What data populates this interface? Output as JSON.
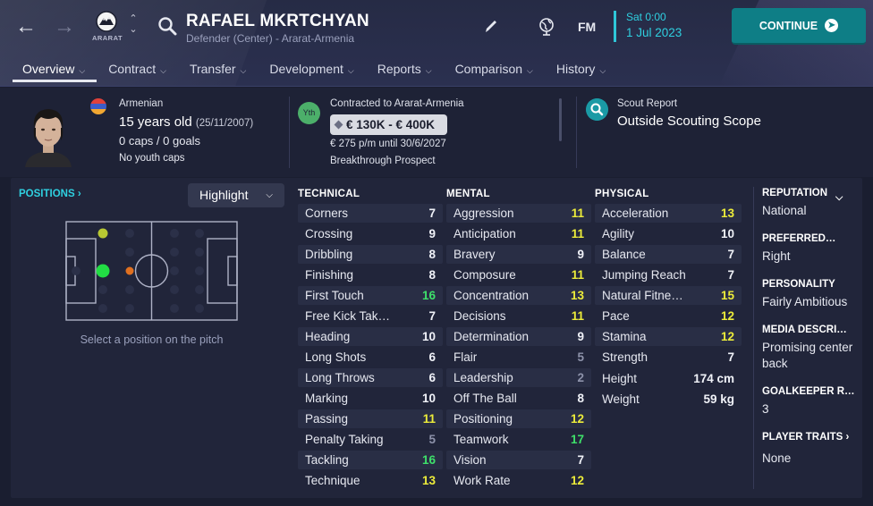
{
  "header": {
    "club_name": "ARARAT",
    "player_name": "RAFAEL MKRTCHYAN",
    "subtitle": "Defender (Center) - Ararat-Armenia",
    "date_day": "Sat 0:00",
    "date_date": "1 Jul 2023",
    "fm_label": "FM",
    "continue_label": "CONTINUE",
    "icons": {
      "back": "arrow-left-icon",
      "forward": "arrow-right-icon",
      "search": "search-icon",
      "edit": "pencil-icon",
      "world": "globe-icon"
    }
  },
  "tabs": [
    {
      "label": "Overview"
    },
    {
      "label": "Contract"
    },
    {
      "label": "Transfer"
    },
    {
      "label": "Development"
    },
    {
      "label": "Reports"
    },
    {
      "label": "Comparison"
    },
    {
      "label": "History"
    }
  ],
  "info": {
    "nationality": "Armenian",
    "age": "15 years old",
    "dob": "(25/11/2007)",
    "caps": "0 caps / 0 goals",
    "youth_caps": "No youth caps",
    "yth_badge": "Yth",
    "contract": "Contracted to Ararat-Armenia",
    "value": "€ 130K - € 400K",
    "wage": "€ 275 p/m until 30/6/2027",
    "prospect": "Breakthrough Prospect",
    "scout_label": "Scout Report",
    "scout_value": "Outside Scouting Scope"
  },
  "positions": {
    "title": "POSITIONS",
    "highlight_label": "Highlight",
    "hint": "Select a position on the pitch"
  },
  "technical": {
    "title": "TECHNICAL",
    "attributes": [
      {
        "name": "Corners",
        "value": "7"
      },
      {
        "name": "Crossing",
        "value": "9"
      },
      {
        "name": "Dribbling",
        "value": "8"
      },
      {
        "name": "Finishing",
        "value": "8"
      },
      {
        "name": "First Touch",
        "value": "16"
      },
      {
        "name": "Free Kick Tak…",
        "value": "7"
      },
      {
        "name": "Heading",
        "value": "10"
      },
      {
        "name": "Long Shots",
        "value": "6"
      },
      {
        "name": "Long Throws",
        "value": "6"
      },
      {
        "name": "Marking",
        "value": "10"
      },
      {
        "name": "Passing",
        "value": "11"
      },
      {
        "name": "Penalty Taking",
        "value": "5"
      },
      {
        "name": "Tackling",
        "value": "16"
      },
      {
        "name": "Technique",
        "value": "13"
      }
    ]
  },
  "mental": {
    "title": "MENTAL",
    "attributes": [
      {
        "name": "Aggression",
        "value": "11"
      },
      {
        "name": "Anticipation",
        "value": "11"
      },
      {
        "name": "Bravery",
        "value": "9"
      },
      {
        "name": "Composure",
        "value": "11"
      },
      {
        "name": "Concentration",
        "value": "13"
      },
      {
        "name": "Decisions",
        "value": "11"
      },
      {
        "name": "Determination",
        "value": "9"
      },
      {
        "name": "Flair",
        "value": "5"
      },
      {
        "name": "Leadership",
        "value": "2"
      },
      {
        "name": "Off The Ball",
        "value": "8"
      },
      {
        "name": "Positioning",
        "value": "12"
      },
      {
        "name": "Teamwork",
        "value": "17"
      },
      {
        "name": "Vision",
        "value": "7"
      },
      {
        "name": "Work Rate",
        "value": "12"
      }
    ]
  },
  "physical": {
    "title": "PHYSICAL",
    "attributes": [
      {
        "name": "Acceleration",
        "value": "13"
      },
      {
        "name": "Agility",
        "value": "10"
      },
      {
        "name": "Balance",
        "value": "7"
      },
      {
        "name": "Jumping Reach",
        "value": "7"
      },
      {
        "name": "Natural Fitne…",
        "value": "15"
      },
      {
        "name": "Pace",
        "value": "12"
      },
      {
        "name": "Stamina",
        "value": "12"
      },
      {
        "name": "Strength",
        "value": "7"
      }
    ],
    "height_label": "Height",
    "height_value": "174 cm",
    "weight_label": "Weight",
    "weight_value": "59 kg"
  },
  "sidebar": {
    "reputation_label": "REPUTATION",
    "reputation_value": "National",
    "preferred_label": "PREFERRED…",
    "preferred_value": "Right",
    "personality_label": "PERSONALITY",
    "personality_value": "Fairly Ambitious",
    "media_label": "MEDIA DESCRI…",
    "media_value": "Promising center back",
    "gk_label": "GOALKEEPER R…",
    "gk_value": "3",
    "traits_label": "PLAYER TRAITS",
    "traits_value": "None"
  },
  "colors": {
    "accent": "#2fd0e0",
    "continue_bg": "#0e7e86",
    "attr_grey": "#8d92aa",
    "attr_white": "#f0f2f8",
    "attr_yellow": "#ecec3a",
    "attr_green": "#3ee06a",
    "pos_natural": "#22dd44",
    "pos_accomplished": "#b8c832",
    "pos_unconvincing": "#e07020"
  }
}
